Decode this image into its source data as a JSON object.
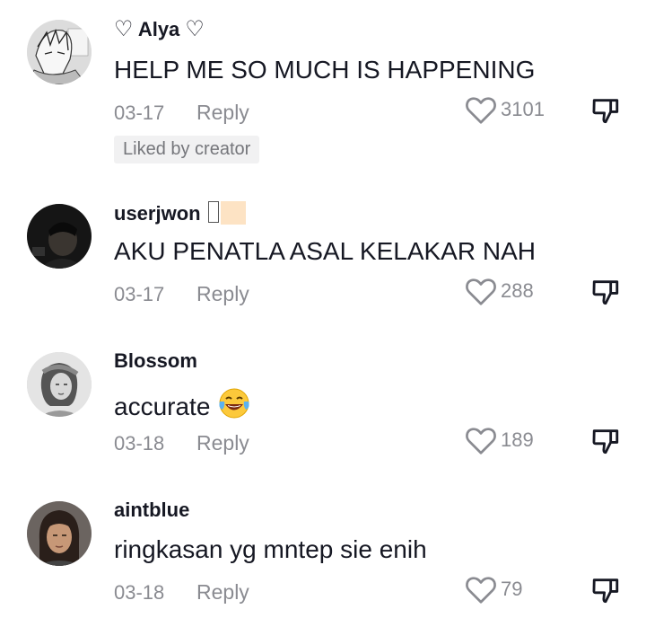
{
  "comments": [
    {
      "heart_left": "♡",
      "username": "Alya",
      "heart_right": "♡",
      "text": "HELP ME SO MUCH IS HAPPENING",
      "date": "03-17",
      "reply_label": "Reply",
      "likes": "3101",
      "badge": "Liked by creator",
      "avatar": "manga-character-avatar"
    },
    {
      "username": "userjwon",
      "text": "AKU PENATLA ASAL KELAKAR NAH",
      "date": "03-17",
      "reply_label": "Reply",
      "likes": "288",
      "avatar": "dark-photo-avatar"
    },
    {
      "username": "Blossom",
      "text": "accurate",
      "emoji": "😂",
      "date": "03-18",
      "reply_label": "Reply",
      "likes": "189",
      "avatar": "vintage-woman-avatar"
    },
    {
      "username": "aintblue",
      "text": "ringkasan yg mntep sie enih",
      "date": "03-18",
      "reply_label": "Reply",
      "likes": "79",
      "avatar": "girl-photo-avatar"
    }
  ],
  "colors": {
    "text": "#161823",
    "muted": "#8a8b91",
    "badge_bg": "#f1f1f2"
  }
}
